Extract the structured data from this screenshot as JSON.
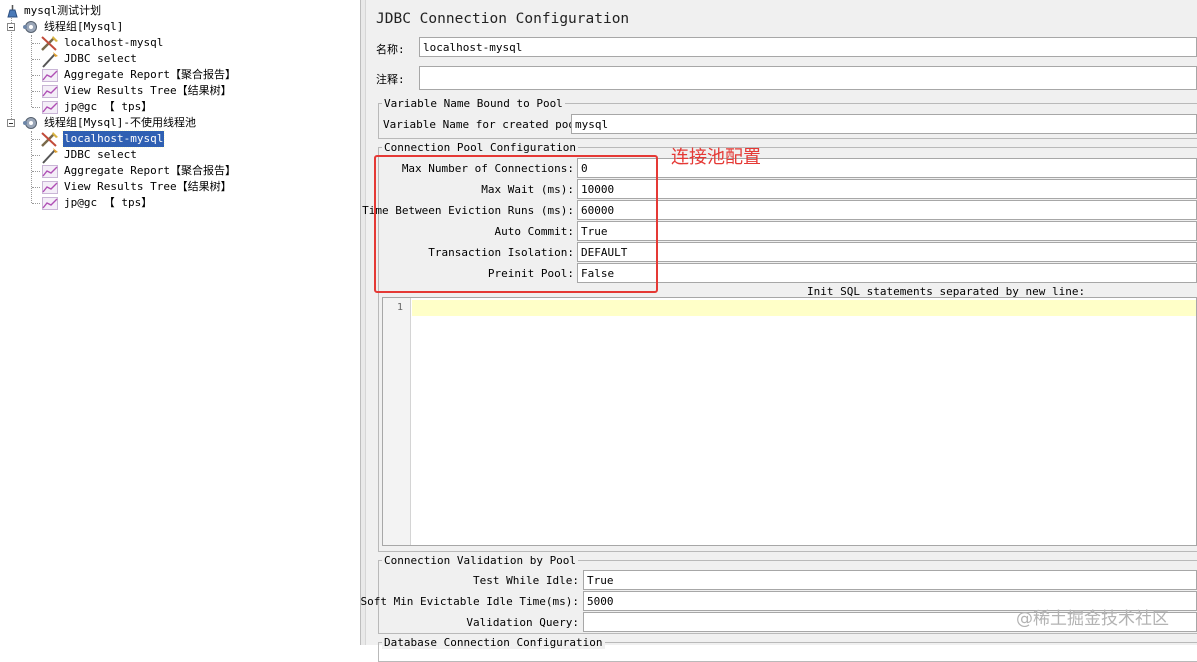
{
  "tree": {
    "root": "mysql测试计划",
    "group1": {
      "label": "线程组[Mysql]",
      "items": [
        "localhost-mysql",
        "JDBC select",
        "Aggregate Report【聚合报告】",
        "View Results Tree【结果树】",
        "jp@gc 【 tps】"
      ]
    },
    "group2": {
      "label": "线程组[Mysql]-不使用线程池",
      "items": [
        "localhost-mysql",
        "JDBC select",
        "Aggregate Report【聚合报告】",
        "View Results Tree【结果树】",
        "jp@gc 【 tps】"
      ]
    }
  },
  "panel": {
    "title": "JDBC Connection Configuration",
    "name_label": "名称:",
    "name_value": "localhost-mysql",
    "comment_label": "注释:",
    "comment_value": "",
    "var_group": {
      "legend": "Variable Name Bound to Pool",
      "label": "Variable Name for created pool:",
      "value": "mysql"
    },
    "pool_group": {
      "legend": "Connection Pool Configuration",
      "rows": [
        {
          "label": "Max Number of Connections:",
          "value": "0"
        },
        {
          "label": "Max Wait (ms):",
          "value": "10000"
        },
        {
          "label": "Time Between Eviction Runs (ms):",
          "value": "60000"
        },
        {
          "label": "Auto Commit:",
          "value": "True"
        },
        {
          "label": "Transaction Isolation:",
          "value": "DEFAULT"
        },
        {
          "label": "Preinit Pool:",
          "value": "False"
        }
      ],
      "sql_caption": "Init SQL statements separated by new line:",
      "sql_line_number": "1"
    },
    "validation_group": {
      "legend": "Connection Validation by Pool",
      "rows": [
        {
          "label": "Test While Idle:",
          "value": "True"
        },
        {
          "label": "Soft Min Evictable Idle Time(ms):",
          "value": "5000"
        },
        {
          "label": "Validation Query:",
          "value": ""
        }
      ]
    },
    "next_group_legend": "Database Connection Configuration"
  },
  "annotation": "连接池配置",
  "annotation_color": "#e53935",
  "selection_color": "#2f60b3",
  "watermark": "@稀土掘金技术社区"
}
